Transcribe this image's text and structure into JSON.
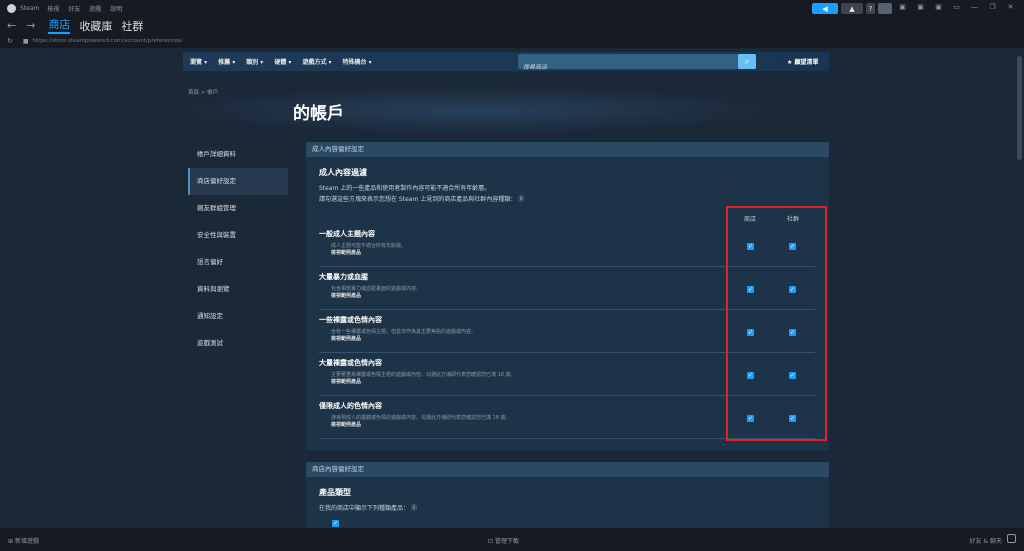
{
  "titlebar": {
    "app_name": "Steam",
    "menu": [
      "檢視",
      "好友",
      "遊戲",
      "說明"
    ]
  },
  "nav": {
    "tabs": [
      "商店",
      "收藏庫",
      "社群"
    ],
    "active_tab": "商店",
    "url": "https://store.steampowered.com/account/preferences/"
  },
  "storenav": {
    "items": [
      "瀏覽 ▾",
      "推薦 ▾",
      "類別 ▾",
      "硬體 ▾",
      "遊戲方式 ▾",
      "特殊機台 ▾"
    ],
    "search_placeholder": "搜尋商店",
    "wishlist_label": "願望清單"
  },
  "breadcrumb": "首頁 > 帳戶",
  "page_title": "的帳戶",
  "leftmenu": {
    "items": [
      "帳戶詳細資料",
      "商店偏好設定",
      "親友群組管理",
      "安全性與裝置",
      "語言偏好",
      "資料與瀏覽",
      "通知設定",
      "遊戲測試"
    ],
    "active_index": 1
  },
  "section1": {
    "header": "成人內容偏好設定",
    "title": "成人內容過濾",
    "desc1": "Steam 上的一些產品和使用者製作內容可能不適合所有年齡層。",
    "desc2": "請勾選這些方塊來表示您想在 Steam 上見到的商店產品與社群內容種類：",
    "col_store": "商店",
    "col_community": "社群",
    "rows": [
      {
        "title": "一般成人主題內容",
        "desc": "成人主題可能不適合所有年齡層。",
        "example": "檢視範例產品",
        "store": true,
        "community": true
      },
      {
        "title": "大量暴力或血腥",
        "desc": "包含相當暴力或血腥畫面的遊戲或內容。",
        "example": "檢視範例產品",
        "store": true,
        "community": true
      },
      {
        "title": "一些裸露或色情內容",
        "desc": "含有一些裸露或色情主題，但並非作為其主要焦點的遊戲或內容。",
        "example": "檢視範例產品",
        "store": true,
        "community": true
      },
      {
        "title": "大量裸露或色情內容",
        "desc": "主要著重為裸露或色情主題的遊戲或內容。勾選此方塊即代表您確認您已滿 18 歲。",
        "example": "檢視範例產品",
        "store": true,
        "community": true
      },
      {
        "title": "僅限成人的色情內容",
        "desc": "游導現成人的露體或色情的遊戲或內容。勾選此方塊即代表您確認您已滿 18 歲。",
        "example": "檢視範例產品",
        "store": true,
        "community": true
      }
    ]
  },
  "section2": {
    "header": "商店內容偏好設定",
    "title": "產品類型",
    "desc": "在我的商店中顯示下列種類產品："
  },
  "bottombar": {
    "add_game": "新增遊戲",
    "downloads": "管理下載",
    "friends": "好友 & 聊天"
  },
  "colors": {
    "accent": "#1a9fff",
    "highlight_box": "#e0202a",
    "section_header": "#2a4963"
  }
}
